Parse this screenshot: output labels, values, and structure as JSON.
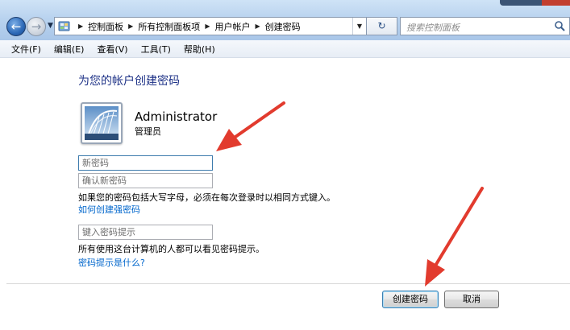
{
  "address_bar": {
    "breadcrumbs": [
      "控制面板",
      "所有控制面板项",
      "用户帐户",
      "创建密码"
    ]
  },
  "search": {
    "placeholder": "搜索控制面板"
  },
  "menu": [
    "文件(F)",
    "编辑(E)",
    "查看(V)",
    "工具(T)",
    "帮助(H)"
  ],
  "page": {
    "title": "为您的帐户创建密码",
    "user": {
      "name": "Administrator",
      "role": "管理员"
    },
    "fields": {
      "new_password_placeholder": "新密码",
      "confirm_password_placeholder": "确认新密码",
      "hint_placeholder": "键入密码提示"
    },
    "case_note": "如果您的密码包括大写字母，必须在每次登录时以相同方式键入。",
    "strong_password_link": "如何创建强密码",
    "hint_note": "所有使用这台计算机的人都可以看见密码提示。",
    "hint_link": "密码提示是什么?"
  },
  "buttons": {
    "create": "创建密码",
    "cancel": "取消"
  },
  "colors": {
    "title": "#1e3287",
    "link": "#0066cc",
    "annotation_arrow": "#e23b2e"
  }
}
